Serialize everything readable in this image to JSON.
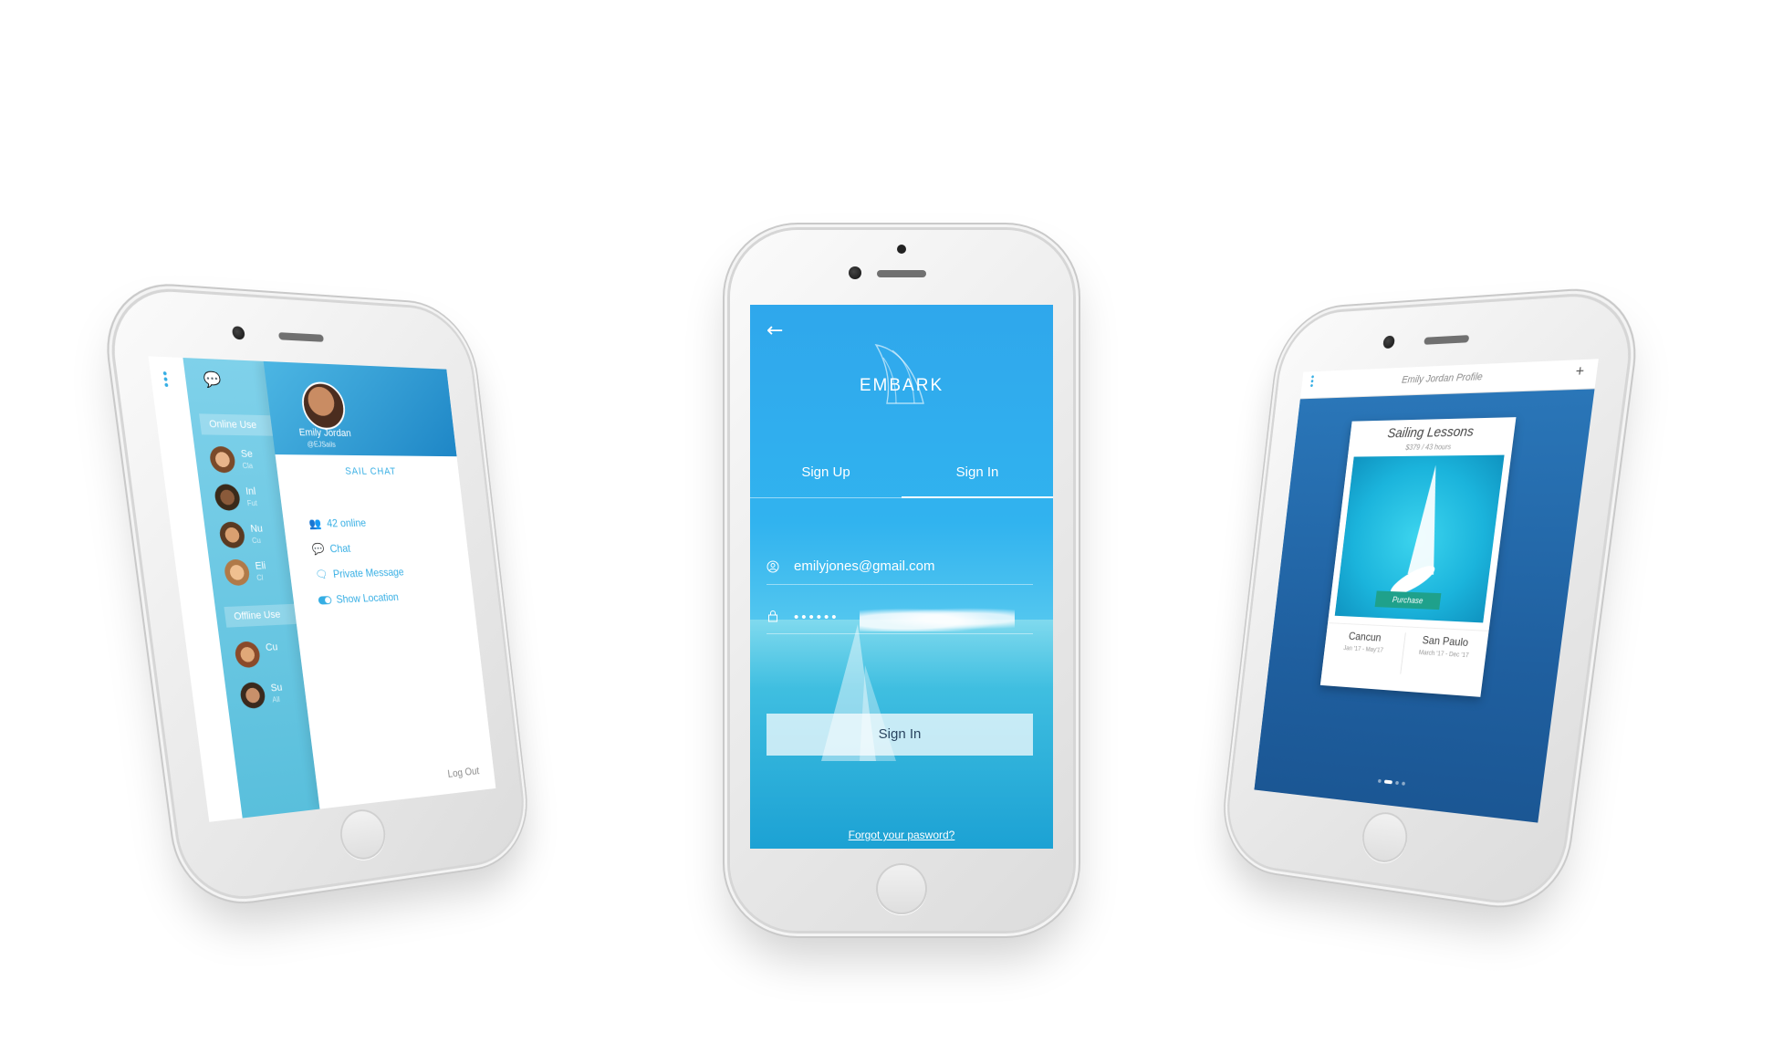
{
  "center": {
    "brand": "EMBARK",
    "tabs": [
      "Sign Up",
      "Sign In"
    ],
    "email_value": "emilyjones@gmail.com",
    "password_mask": "••••••",
    "submit_label": "Sign In",
    "forgot_label": "Forgot your pasword?"
  },
  "left": {
    "profile_name": "Emily Jordan",
    "profile_handle": "@EJSails",
    "brand": "SAIL CHAT",
    "online_section": "Online Use",
    "offline_section": "Offline Use",
    "users_online": [
      {
        "name": "Se",
        "sub": "Cla"
      },
      {
        "name": "Inl",
        "sub": "Fut"
      },
      {
        "name": "Nu",
        "sub": "Cu"
      },
      {
        "name": "Eli",
        "sub": "Cl"
      }
    ],
    "users_offline": [
      {
        "name": "Cu",
        "sub": ""
      },
      {
        "name": "Su",
        "sub": "All"
      }
    ],
    "menu": {
      "online": "42 online",
      "chat": "Chat",
      "private": "Private Message",
      "location": "Show Location",
      "logout": "Log Out"
    }
  },
  "right": {
    "title": "Emily Jordan Profile",
    "plus": "+",
    "card_title": "Sailing Lessons",
    "card_sub": "$379 / 43 hours",
    "purchase_label": "Purchase",
    "date1_city": "Cancun",
    "date1_range": "Jan '17 - May'17",
    "date2_city": "San Paulo",
    "date2_range": "March '17 - Dec '17"
  },
  "colors": {
    "accent": "#35aee4",
    "purchase": "#1fa18b"
  }
}
